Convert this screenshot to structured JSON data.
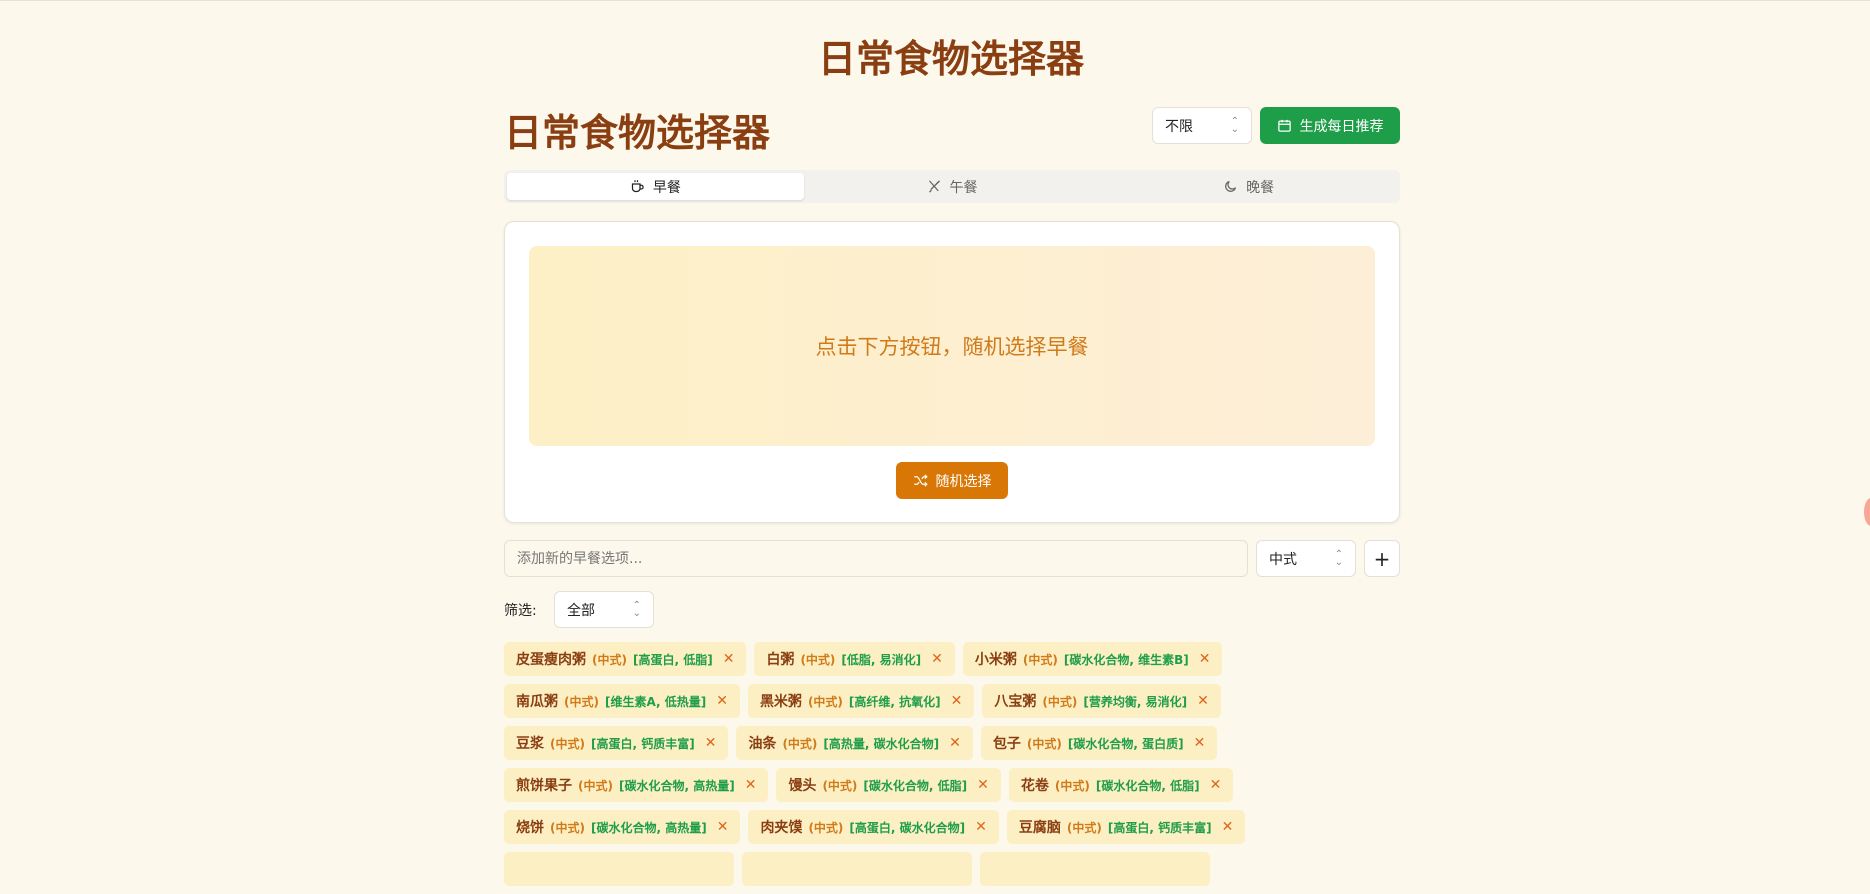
{
  "app": {
    "page_title": "日常食物选择器"
  },
  "header": {
    "section_title": "日常食物选择器",
    "cuisine_select_value": "不限",
    "generate_button_label": "生成每日推荐"
  },
  "tabs": [
    {
      "label": "早餐",
      "icon": "coffee-cup-icon"
    },
    {
      "label": "午餐",
      "icon": "utensils-crossed-icon"
    },
    {
      "label": "晚餐",
      "icon": "moon-icon"
    }
  ],
  "card": {
    "prompt_text": "点击下方按钮，随机选择早餐",
    "random_button_label": "随机选择"
  },
  "add_form": {
    "placeholder": "添加新的早餐选项...",
    "cuisine_value": "中式",
    "add_icon": "plus-icon"
  },
  "filter": {
    "label": "筛选:",
    "value": "全部"
  },
  "foods": [
    {
      "name": "皮蛋瘦肉粥",
      "cuisine": "(中式)",
      "tags": "[高蛋白, 低脂]"
    },
    {
      "name": "白粥",
      "cuisine": "(中式)",
      "tags": "[低脂, 易消化]"
    },
    {
      "name": "小米粥",
      "cuisine": "(中式)",
      "tags": "[碳水化合物, 维生素B]"
    },
    {
      "name": "南瓜粥",
      "cuisine": "(中式)",
      "tags": "[维生素A, 低热量]"
    },
    {
      "name": "黑米粥",
      "cuisine": "(中式)",
      "tags": "[高纤维, 抗氧化]"
    },
    {
      "name": "八宝粥",
      "cuisine": "(中式)",
      "tags": "[营养均衡, 易消化]"
    },
    {
      "name": "豆浆",
      "cuisine": "(中式)",
      "tags": "[高蛋白, 钙质丰富]"
    },
    {
      "name": "油条",
      "cuisine": "(中式)",
      "tags": "[高热量, 碳水化合物]"
    },
    {
      "name": "包子",
      "cuisine": "(中式)",
      "tags": "[碳水化合物, 蛋白质]"
    },
    {
      "name": "煎饼果子",
      "cuisine": "(中式)",
      "tags": "[碳水化合物, 高热量]"
    },
    {
      "name": "馒头",
      "cuisine": "(中式)",
      "tags": "[碳水化合物, 低脂]"
    },
    {
      "name": "花卷",
      "cuisine": "(中式)",
      "tags": "[碳水化合物, 低脂]"
    },
    {
      "name": "烧饼",
      "cuisine": "(中式)",
      "tags": "[碳水化合物, 高热量]"
    },
    {
      "name": "肉夹馍",
      "cuisine": "(中式)",
      "tags": "[高蛋白, 碳水化合物]"
    },
    {
      "name": "豆腐脑",
      "cuisine": "(中式)",
      "tags": "[高蛋白, 钙质丰富]"
    }
  ],
  "colors": {
    "brand_brown": "#8a3f12",
    "accent_orange": "#d97706",
    "accent_green": "#1f9e4a",
    "background": "#fdf8ec"
  }
}
